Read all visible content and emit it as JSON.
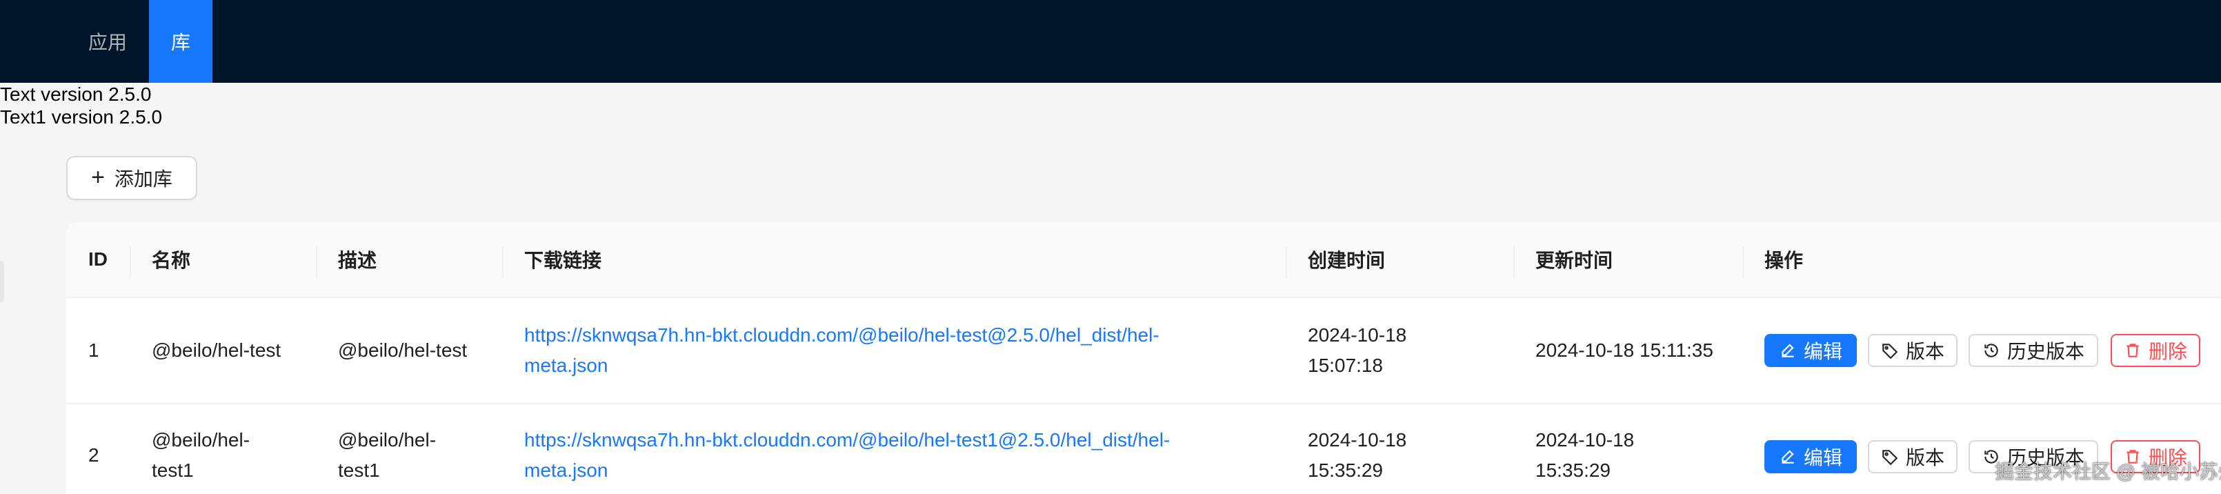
{
  "nav": {
    "items": [
      {
        "label": "应用"
      },
      {
        "label": "库"
      }
    ]
  },
  "versions": [
    "Text version 2.5.0",
    "Text1 version 2.5.0"
  ],
  "add_button": {
    "label": "添加库",
    "icon": "plus-icon"
  },
  "table": {
    "columns": [
      "ID",
      "名称",
      "描述",
      "下载链接",
      "创建时间",
      "更新时间",
      "操作"
    ],
    "rows": [
      {
        "id": "1",
        "name_lines": [
          "@beilo/hel-test"
        ],
        "desc_lines": [
          "@beilo/hel-test"
        ],
        "link_lines": [
          "https://sknwqsa7h.hn-bkt.clouddn.com/@beilo/hel-test@2.5.0/hel_dist/hel-",
          "meta.json"
        ],
        "created_lines": [
          "2024-10-18",
          "15:07:18"
        ],
        "updated_lines": [
          "2024-10-18 15:11:35"
        ]
      },
      {
        "id": "2",
        "name_lines": [
          "@beilo/hel-",
          "test1"
        ],
        "desc_lines": [
          "@beilo/hel-",
          "test1"
        ],
        "link_lines": [
          "https://sknwqsa7h.hn-bkt.clouddn.com/@beilo/hel-test1@2.5.0/hel_dist/hel-",
          "meta.json"
        ],
        "created_lines": [
          "2024-10-18",
          "15:35:29"
        ],
        "updated_lines": [
          "2024-10-18",
          "15:35:29"
        ]
      }
    ],
    "actions": {
      "edit": "编辑",
      "version": "版本",
      "history": "历史版本",
      "delete": "删除"
    }
  },
  "watermark": "掘金技术社区 @ 被哈小苏州",
  "colors": {
    "header_bg": "#001529",
    "active_nav": "#1677ff",
    "primary": "#1677ff",
    "danger": "#ff4d4f",
    "page_bg": "#f5f5f5"
  }
}
